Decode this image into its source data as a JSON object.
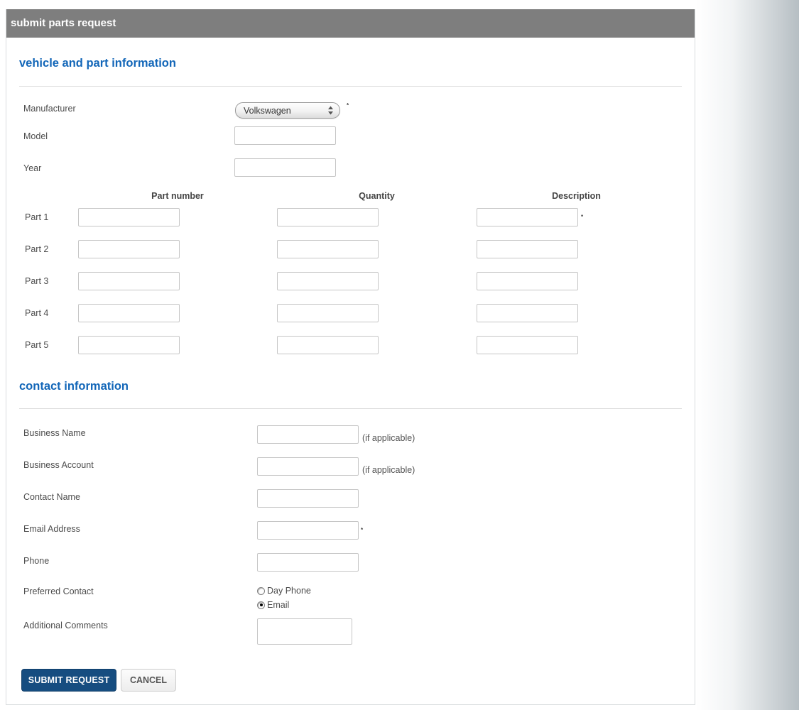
{
  "colors": {
    "title_bar_bg": "#7e7e7e",
    "section_heading": "#1266b8",
    "submit_button_bg": "#164d80",
    "page_gradient_end": "#b6bec3"
  },
  "title_bar": {
    "label": "submit parts request"
  },
  "vehicle_section": {
    "heading": "vehicle and part information",
    "manufacturer_label": "Manufacturer",
    "manufacturer_value": "Volkswagen",
    "manufacturer_required": "*",
    "model_label": "Model",
    "model_value": "",
    "year_label": "Year",
    "year_value": ""
  },
  "parts_table": {
    "headers": {
      "part_number": "Part number",
      "quantity": "Quantity",
      "description": "Description"
    },
    "rows": [
      {
        "label": "Part 1",
        "part_number": "",
        "quantity": "",
        "description": "",
        "required": "*"
      },
      {
        "label": "Part 2",
        "part_number": "",
        "quantity": "",
        "description": ""
      },
      {
        "label": "Part 3",
        "part_number": "",
        "quantity": "",
        "description": ""
      },
      {
        "label": "Part 4",
        "part_number": "",
        "quantity": "",
        "description": ""
      },
      {
        "label": "Part 5",
        "part_number": "",
        "quantity": "",
        "description": ""
      }
    ]
  },
  "contact_section": {
    "heading": "contact information",
    "business_name": {
      "label": "Business Name",
      "value": "",
      "note": "(if applicable)"
    },
    "business_account": {
      "label": "Business Account",
      "value": "",
      "note": "(if applicable)"
    },
    "contact_name": {
      "label": "Contact Name",
      "value": ""
    },
    "email_address": {
      "label": "Email Address",
      "value": "",
      "required": "*"
    },
    "phone": {
      "label": "Phone",
      "value": ""
    },
    "preferred_contact": {
      "label": "Preferred Contact",
      "options": [
        {
          "label": "Day Phone",
          "selected": false
        },
        {
          "label": "Email",
          "selected": true
        }
      ]
    },
    "additional_comments": {
      "label": "Additional Comments",
      "value": ""
    }
  },
  "actions": {
    "submit_label": "SUBMIT REQUEST",
    "cancel_label": "CANCEL"
  }
}
